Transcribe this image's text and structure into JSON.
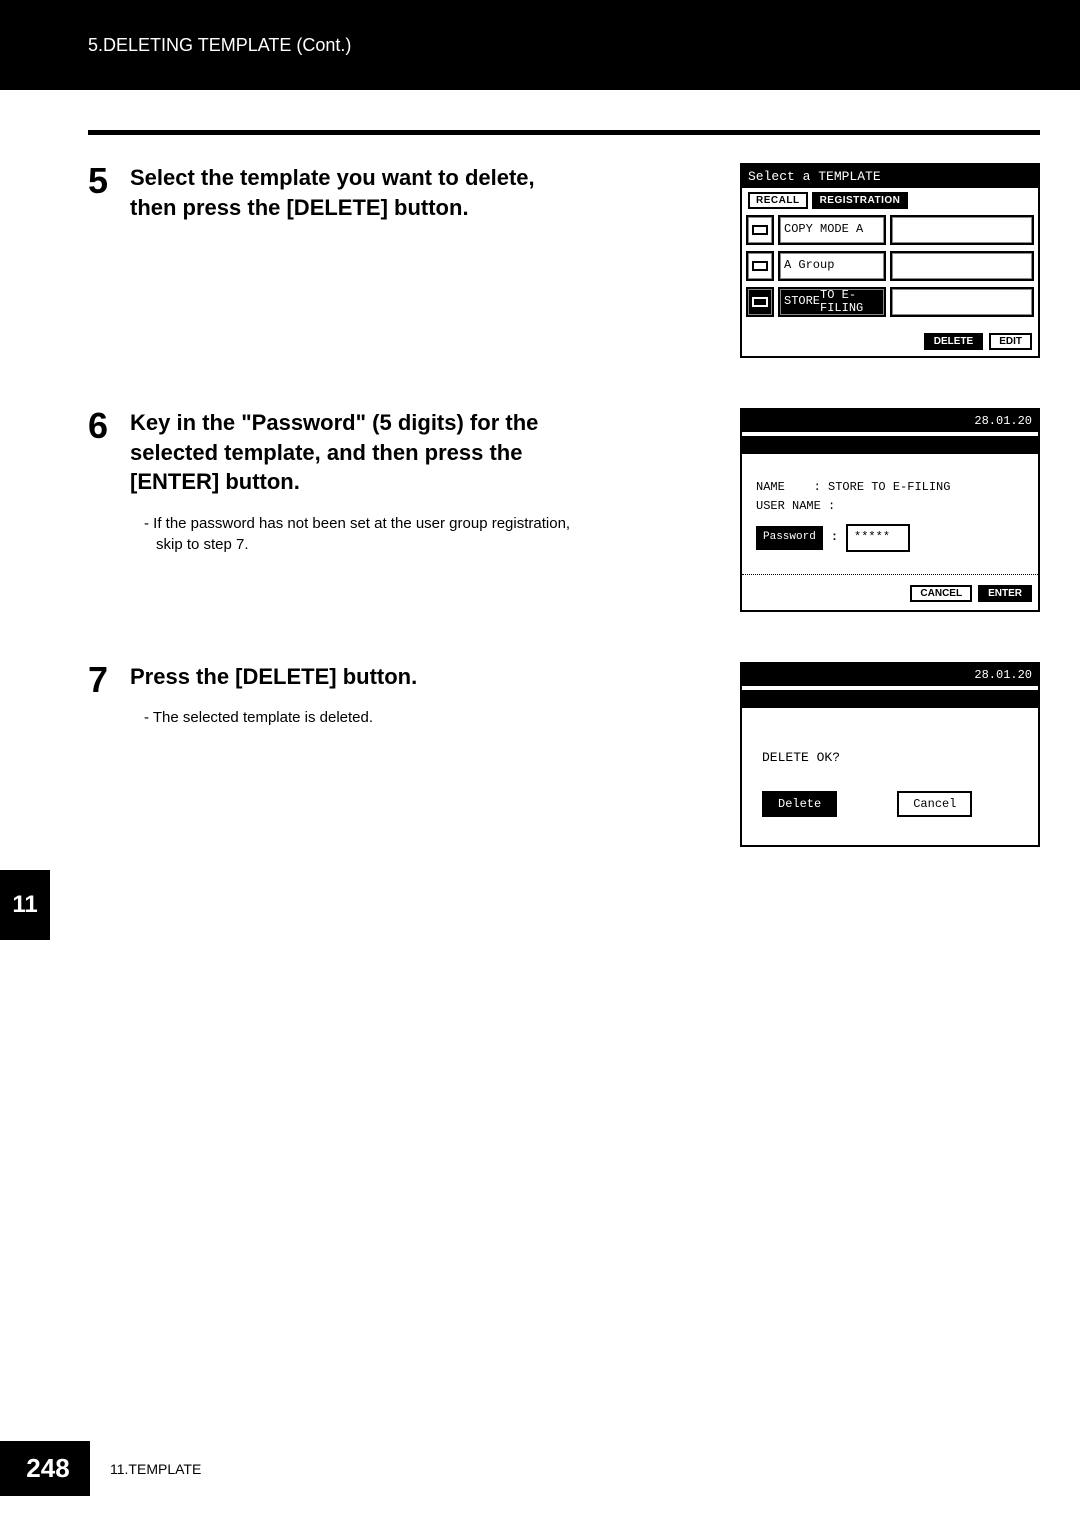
{
  "header": {
    "breadcrumb": "5.DELETING TEMPLATE (Cont.)"
  },
  "steps": {
    "s5": {
      "num": "5",
      "title": "Select the template you want to delete, then press the [DELETE] button."
    },
    "s6": {
      "num": "6",
      "title": "Key in the \"Password\" (5 digits) for the selected template, and then press the [ENTER] button.",
      "note": "-  If the password has not been set at the user group registration, skip to step 7."
    },
    "s7": {
      "num": "7",
      "title": "Press the [DELETE] button.",
      "note": "-  The selected template is deleted."
    }
  },
  "screen1": {
    "header": "Select a TEMPLATE",
    "tabs": {
      "recall": "RECALL",
      "registration": "REGISTRATION"
    },
    "rows": {
      "r1": "COPY MODE A",
      "r2": "A Group",
      "r3a": "STORE",
      "r3b": "TO E-FILING"
    },
    "buttons": {
      "delete": "DELETE",
      "edit": "EDIT"
    }
  },
  "screen2": {
    "date": "28.01.20",
    "name_label": "NAME",
    "name_value": ": STORE TO E-FILING",
    "user_label": "USER NAME",
    "user_value": ":",
    "pw_label": "Password",
    "pw_value": "*****",
    "buttons": {
      "cancel": "CANCEL",
      "enter": "ENTER"
    }
  },
  "screen3": {
    "date": "28.01.20",
    "prompt": "DELETE OK?",
    "buttons": {
      "delete": "Delete",
      "cancel": "Cancel"
    }
  },
  "chapter": {
    "num": "11"
  },
  "footer": {
    "page": "248",
    "label": "11.TEMPLATE"
  }
}
